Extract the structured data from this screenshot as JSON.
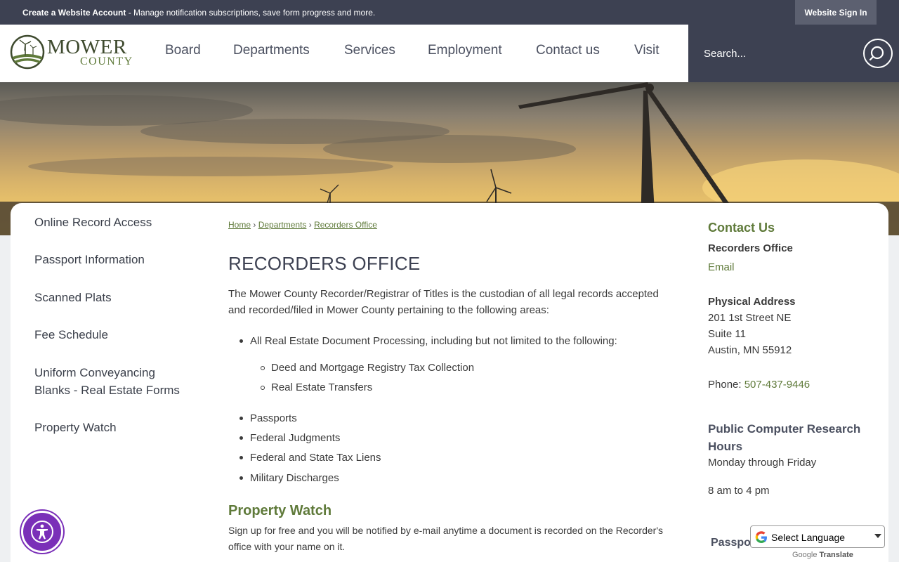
{
  "topbar": {
    "create_account": "Create a Website Account",
    "message": " - Manage notification subscriptions, save form progress and more.",
    "signin": "Website Sign In"
  },
  "logo": {
    "line1": "MOWER",
    "line2": "COUNTY"
  },
  "nav": [
    "Board",
    "Departments",
    "Services",
    "Employment",
    "Contact us",
    "Visit"
  ],
  "search": {
    "placeholder": "Search..."
  },
  "sidenav": [
    "Online Record Access",
    "Passport Information",
    "Scanned Plats",
    "Fee Schedule",
    "Uniform Conveyancing",
    "Blanks - Real Estate Forms",
    "Property Watch"
  ],
  "breadcrumb": {
    "home": "Home",
    "sep": "›",
    "departments": "Departments",
    "current": "Recorders Office"
  },
  "main": {
    "title": "RECORDERS OFFICE",
    "intro": "The Mower County Recorder/Registrar of Titles is the custodian of all legal records accepted and recorded/filed in Mower County pertaining to the following areas:",
    "list_top": "All Real Estate Document Processing, including but not limited to the following:",
    "sublist": [
      "Deed and Mortgage Registry Tax Collection",
      "Real Estate Transfers"
    ],
    "list_rest": [
      "Passports",
      "Federal Judgments",
      "Federal and State Tax Liens",
      "Military Discharges"
    ],
    "property_watch_title": "Property Watch",
    "property_watch_text": "Sign up for free and you will be notified by e-mail anytime a document is recorded on the Recorder's office with your name on it."
  },
  "contact": {
    "heading": "Contact Us",
    "office": "Recorders Office",
    "email": "Email",
    "address_label": "Physical Address",
    "address_lines": [
      "201 1st Street NE",
      "Suite 11",
      "Austin, MN 55912"
    ],
    "phone_label": "Phone: ",
    "phone": "507-437-9446",
    "hours_title": "Public Computer Research Hours",
    "hours_days": "Monday through Friday",
    "hours_time": "8 am to 4 pm",
    "passport_partial": "Passport"
  },
  "translate": {
    "label": "Select Language",
    "powered_google": "Google",
    "powered_translate": "Translate"
  },
  "colors": {
    "accent_green": "#5f7a3a",
    "dark_bar": "#3d4152",
    "a11y_purple": "#7a2fb8"
  }
}
